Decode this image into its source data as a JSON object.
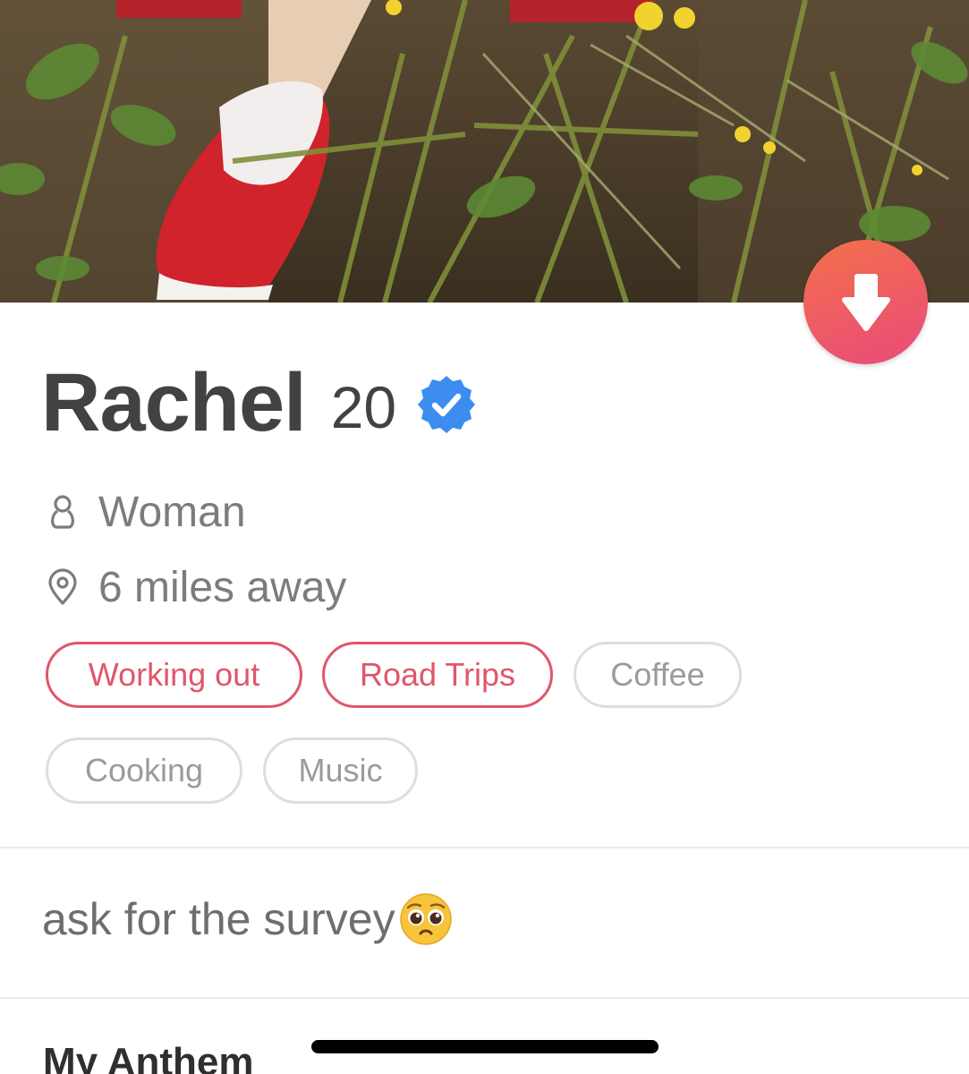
{
  "profile": {
    "name": "Rachel",
    "age": "20",
    "verified_icon": "verified-badge-icon",
    "gender": "Woman",
    "gender_icon": "person-icon",
    "distance": "6 miles away",
    "distance_icon": "location-pin-icon"
  },
  "interests": [
    {
      "label": "Working out",
      "shared": true
    },
    {
      "label": "Road Trips",
      "shared": true
    },
    {
      "label": "Coffee",
      "shared": false
    },
    {
      "label": "Cooking",
      "shared": false
    },
    {
      "label": "Music",
      "shared": false
    }
  ],
  "bio": {
    "text": "ask for the survey",
    "emoji": "pleading-face-emoji"
  },
  "sections": {
    "anthem_title": "My Anthem"
  },
  "actions": {
    "collapse_icon": "arrow-down-icon"
  },
  "colors": {
    "accent_gradient_start": "#f3704a",
    "accent_gradient_end": "#ea4a7a",
    "shared_interest": "#e0566b",
    "verified_blue": "#3d8df0"
  }
}
